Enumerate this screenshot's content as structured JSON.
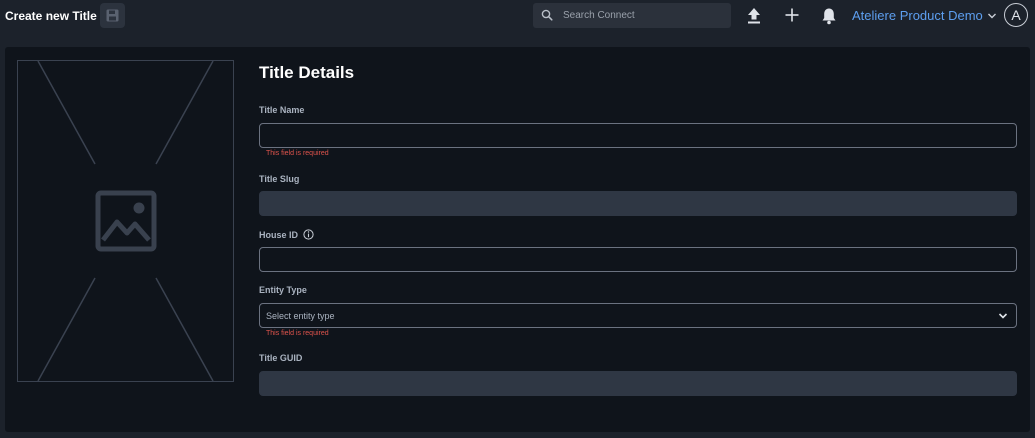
{
  "header": {
    "title": "Create new Title",
    "search_placeholder": "Search Connect",
    "org_name": "Ateliere Product Demo",
    "avatar_initial": "A"
  },
  "form": {
    "section_title": "Title Details",
    "title_name": {
      "label": "Title Name",
      "value": "",
      "error": "This field is required"
    },
    "title_slug": {
      "label": "Title Slug",
      "value": ""
    },
    "house_id": {
      "label": "House ID",
      "value": ""
    },
    "entity_type": {
      "label": "Entity Type",
      "placeholder": "Select entity type",
      "error": "This field is required"
    },
    "title_guid": {
      "label": "Title GUID",
      "value": ""
    }
  },
  "icons": {
    "save": "save-icon",
    "search": "search-icon",
    "upload": "upload-icon",
    "add": "plus-icon",
    "notifications": "bell-icon",
    "org_menu": "chevron-down-icon",
    "info": "info-icon",
    "image": "image-placeholder-icon",
    "select": "chevron-down-icon"
  },
  "colors": {
    "background": "#1c222b",
    "panel": "#0f141b",
    "accent": "#5d9ff0",
    "error": "#e0544c",
    "disabled_input": "#2f3744"
  }
}
